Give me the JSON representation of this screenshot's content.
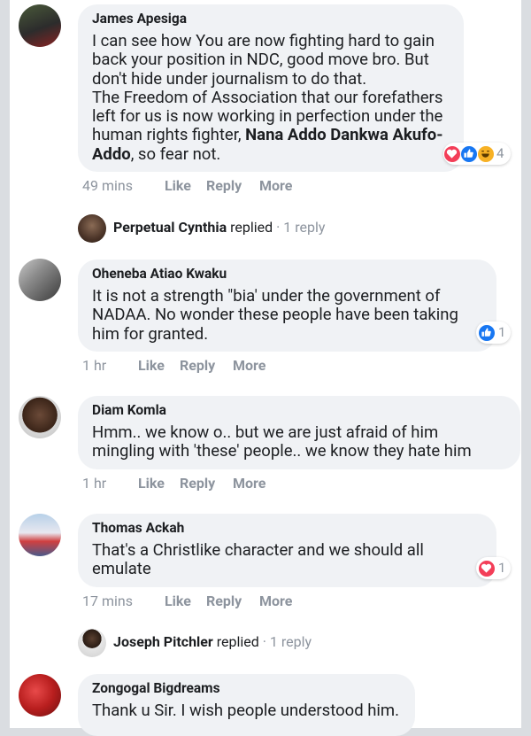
{
  "comments": [
    {
      "name": "James Apesiga",
      "text_lines": [
        "I can see how You are now fighting hard to gain",
        "back your position in NDC, good move bro. But",
        "don't hide under journalism to do that.",
        "The Freedom of Association that our forefathers",
        "left for us is now working in perfection under the"
      ],
      "text_tail_pre": "human rights fighter, ",
      "text_bold": "Nana Addo Dankwa Akufo-",
      "text_bold2": "Addo",
      "text_tail_post": ", so fear not.",
      "time": "49 mins",
      "reaction_count": "4"
    },
    {
      "name": "Oheneba Atiao Kwaku",
      "text_lines": [
        "It is not a strength \"bia' under the government of",
        "NADAA. No wonder these people have been taking",
        "him for granted."
      ],
      "time": "1 hr",
      "reaction_count": "1"
    },
    {
      "name": "Diam Komla",
      "text_lines": [
        "Hmm.. we know o.. but we are just afraid of him",
        "mingling with 'these' people.. we know they hate him"
      ],
      "time": "1 hr"
    },
    {
      "name": "Thomas Ackah",
      "text_lines": [
        "That's a Christlike character and we should all",
        "emulate"
      ],
      "time": "17 mins",
      "reaction_count": "1"
    },
    {
      "name": "Zongogal Bigdreams",
      "text_lines": [
        "Thank u Sir. I wish people understood him."
      ]
    }
  ],
  "replies": [
    {
      "name": "Perpetual Cynthia",
      "verb": "replied",
      "sep": "·",
      "count": "1 reply"
    },
    {
      "name": "Joseph Pitchler",
      "verb": "replied",
      "sep": "·",
      "count": "1 reply"
    }
  ],
  "actions": {
    "like": "Like",
    "reply": "Reply",
    "more": "More"
  },
  "colors": {
    "bubble": "#f0f2f5",
    "like_blue": "#1877f2",
    "love_red": "#f33e58",
    "haha_yellow": "#f7b125",
    "meta_gray": "#8d949e"
  },
  "icons": [
    "love-icon",
    "like-icon",
    "haha-icon"
  ]
}
